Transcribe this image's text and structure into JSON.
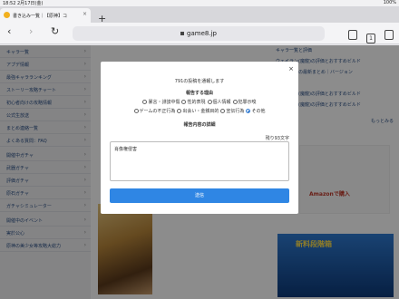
{
  "status_bar": {
    "time": "18:52 2月17日(金)",
    "battery": "100%"
  },
  "browser": {
    "tab_title": "書き込み一覧｜【原神】コ",
    "tab_close": "×",
    "new_tab": "+",
    "url": "game8.jp",
    "back": "‹",
    "forward": "›",
    "reload": "↻",
    "tabs_count": "1"
  },
  "sidebar": {
    "items": [
      {
        "label": "キャラ一覧"
      },
      {
        "label": "アプデ情報"
      },
      {
        "label": "最強キャラランキング"
      },
      {
        "label": "ストーリー攻略チャート"
      },
      {
        "label": "初心者向けの攻略情報"
      },
      {
        "label": "公式生放送"
      },
      {
        "label": "まとめ連絡一覧"
      },
      {
        "label": "よくある質問：FAQ"
      },
      {
        "label": "開催中ガチャ"
      },
      {
        "label": "武器ガチャ"
      },
      {
        "label": "評価ガチャ"
      },
      {
        "label": "原石ガチャ"
      },
      {
        "label": "ガチャシミュレーター"
      },
      {
        "label": "開催中のイベント"
      },
      {
        "label": "実於公心"
      },
      {
        "label": "原神の美少女等攻略大総力"
      }
    ]
  },
  "right_col": {
    "lines": [
      "キャラ一覧と評価",
      "ウェイラン(魔龍)の評価とおすすめビルド",
      "公式生放送の最新まとめ｜バージョン",
      "",
      "ウェイラン(魔龍)の評価とおすすめビルド",
      "ウェイラン(魔龍)の評価とおすすめビルド"
    ],
    "more": "もっとみる",
    "ad_text": "Amazonで購入",
    "ad2_text": "新料段階箱"
  },
  "modal": {
    "close": "×",
    "message": "791の投稿を通報します",
    "reason_heading": "報告する理由",
    "reasons_row1": [
      "暴言・誹謗中傷",
      "性的表現",
      "個人情報",
      "犯罪示唆"
    ],
    "reasons_row2": [
      "ゲームの不正行為",
      "出会い・金銭目的",
      "宣伝行為",
      "その他"
    ],
    "selected": "その他",
    "detail_heading": "報告内容の詳細",
    "remaining": "残り93文字",
    "detail_value": "肖像権侵害",
    "send_label": "送信"
  }
}
